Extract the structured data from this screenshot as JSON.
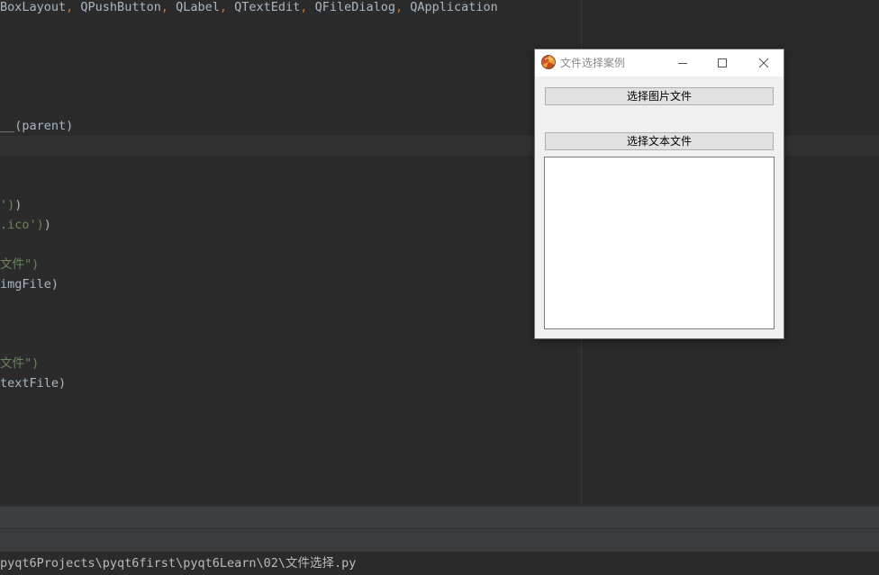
{
  "editor": {
    "lines": [
      {
        "segments": [
          {
            "t": "BoxLayout",
            "c": "default"
          },
          {
            "t": ", ",
            "c": "punct"
          },
          {
            "t": "QPushButton",
            "c": "default"
          },
          {
            "t": ", ",
            "c": "punct"
          },
          {
            "t": "QLabel",
            "c": "default"
          },
          {
            "t": ", ",
            "c": "punct"
          },
          {
            "t": "QTextEdit",
            "c": "default"
          },
          {
            "t": ", ",
            "c": "punct"
          },
          {
            "t": "QFileDialog",
            "c": "default"
          },
          {
            "t": ", ",
            "c": "punct"
          },
          {
            "t": "QApplication",
            "c": "default"
          }
        ]
      },
      {
        "segments": [
          {
            "t": "__(parent)",
            "c": "default"
          }
        ]
      },
      {
        "segments": [
          {
            "t": "')",
            "c": "string"
          },
          {
            "t": ")",
            "c": "default"
          }
        ]
      },
      {
        "segments": [
          {
            "t": ".ico')",
            "c": "string"
          },
          {
            "t": ")",
            "c": "default"
          }
        ]
      },
      {
        "segments": [
          {
            "t": "文件\")",
            "c": "string"
          }
        ]
      },
      {
        "segments": [
          {
            "t": "imgFile)",
            "c": "default"
          }
        ]
      },
      {
        "segments": [
          {
            "t": "文件\")",
            "c": "string"
          }
        ]
      },
      {
        "segments": [
          {
            "t": "textFile)",
            "c": "default"
          }
        ]
      }
    ]
  },
  "status": {
    "path": "pyqt6Projects\\pyqt6first\\pyqt6Learn\\02\\文件选择.py"
  },
  "dialog": {
    "title": "文件选择案例",
    "select_image_button": "选择图片文件",
    "select_text_button": "选择文本文件",
    "text_edit_value": ""
  },
  "icons": {
    "app": "python-logo-icon",
    "minimize": "minimize-icon",
    "maximize": "maximize-icon",
    "close": "close-icon"
  },
  "colors": {
    "editor_bg": "#2b2b2b",
    "code_default": "#a9b7c6",
    "code_punct": "#cc7832",
    "code_string": "#6a8759",
    "dialog_bg": "#f0f0f0"
  }
}
